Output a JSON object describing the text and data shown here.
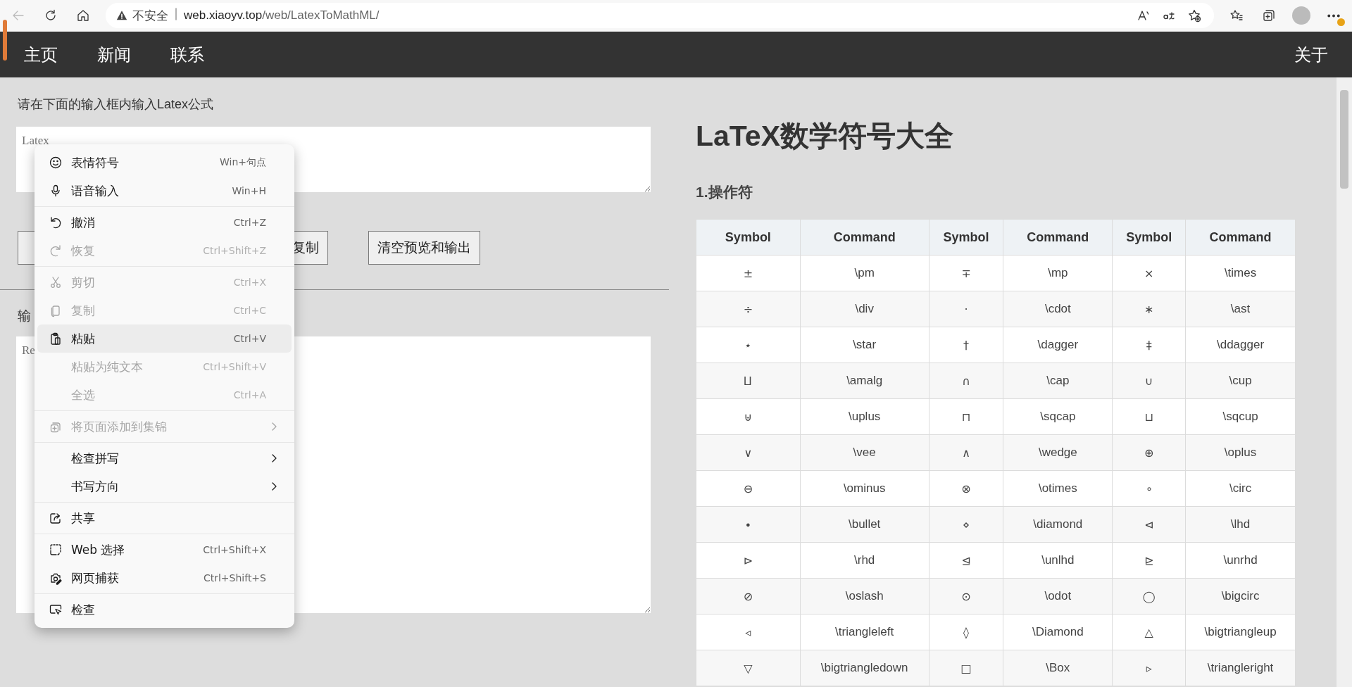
{
  "browser": {
    "security": "不安全",
    "url_host": "web.xiaoyv.top",
    "url_path": "/web/LatexToMathML/",
    "back_disabled": true
  },
  "nav": {
    "items": [
      "主页",
      "新闻",
      "联系"
    ],
    "right": "关于"
  },
  "editor": {
    "instruction": "请在下面的输入框内输入Latex公式",
    "input_placeholder": "Latex",
    "buttons": [
      "复制",
      "清空预览和输出"
    ],
    "output_label": "输",
    "output_placeholder": "Re"
  },
  "reference": {
    "title": "LaTeX数学符号大全",
    "section": "1.操作符",
    "table": {
      "columns": [
        "Symbol",
        "Command",
        "Symbol",
        "Command",
        "Symbol",
        "Command"
      ],
      "rows": [
        [
          "±",
          "\\pm",
          "∓",
          "\\mp",
          "×",
          "\\times"
        ],
        [
          "÷",
          "\\div",
          "·",
          "\\cdot",
          "∗",
          "\\ast"
        ],
        [
          "⋆",
          "\\star",
          "†",
          "\\dagger",
          "‡",
          "\\ddagger"
        ],
        [
          "⨿",
          "\\amalg",
          "∩",
          "\\cap",
          "∪",
          "\\cup"
        ],
        [
          "⊎",
          "\\uplus",
          "⊓",
          "\\sqcap",
          "⊔",
          "\\sqcup"
        ],
        [
          "∨",
          "\\vee",
          "∧",
          "\\wedge",
          "⊕",
          "\\oplus"
        ],
        [
          "⊖",
          "\\ominus",
          "⊗",
          "\\otimes",
          "∘",
          "\\circ"
        ],
        [
          "∙",
          "\\bullet",
          "⋄",
          "\\diamond",
          "⊲",
          "\\lhd"
        ],
        [
          "⊳",
          "\\rhd",
          "⊴",
          "\\unlhd",
          "⊵",
          "\\unrhd"
        ],
        [
          "⊘",
          "\\oslash",
          "⊙",
          "\\odot",
          "◯",
          "\\bigcirc"
        ],
        [
          "◃",
          "\\triangleleft",
          "◊",
          "\\Diamond",
          "△",
          "\\bigtriangleup"
        ],
        [
          "▽",
          "\\bigtriangledown",
          "□",
          "\\Box",
          "▹",
          "\\triangleright"
        ]
      ]
    }
  },
  "context_menu": {
    "groups": [
      [
        {
          "kind": "emoji",
          "label": "表情符号",
          "shortcut": "Win+句点",
          "disabled": false,
          "selected": false,
          "submenu": false
        },
        {
          "kind": "mic",
          "label": "语音输入",
          "shortcut": "Win+H",
          "disabled": false,
          "selected": false,
          "submenu": false
        }
      ],
      [
        {
          "kind": "undo",
          "label": "撤消",
          "shortcut": "Ctrl+Z",
          "disabled": false,
          "selected": false,
          "submenu": false
        },
        {
          "kind": "redo",
          "label": "恢复",
          "shortcut": "Ctrl+Shift+Z",
          "disabled": true,
          "selected": false,
          "submenu": false
        }
      ],
      [
        {
          "kind": "cut",
          "label": "剪切",
          "shortcut": "Ctrl+X",
          "disabled": true,
          "selected": false,
          "submenu": false
        },
        {
          "kind": "copy",
          "label": "复制",
          "shortcut": "Ctrl+C",
          "disabled": true,
          "selected": false,
          "submenu": false
        },
        {
          "kind": "paste",
          "label": "粘贴",
          "shortcut": "Ctrl+V",
          "disabled": false,
          "selected": true,
          "submenu": false
        },
        {
          "kind": "plain",
          "label": "粘贴为纯文本",
          "shortcut": "Ctrl+Shift+V",
          "disabled": true,
          "selected": false,
          "submenu": false
        },
        {
          "kind": "plain",
          "label": "全选",
          "shortcut": "Ctrl+A",
          "disabled": true,
          "selected": false,
          "submenu": false
        }
      ],
      [
        {
          "kind": "collection",
          "label": "将页面添加到集锦",
          "disabled": true,
          "selected": false,
          "submenu": true
        }
      ],
      [
        {
          "kind": "plain",
          "label": "检查拼写",
          "disabled": false,
          "selected": false,
          "submenu": true
        },
        {
          "kind": "plain",
          "label": "书写方向",
          "disabled": false,
          "selected": false,
          "submenu": true
        }
      ],
      [
        {
          "kind": "share",
          "label": "共享",
          "disabled": false,
          "selected": false,
          "submenu": false
        }
      ],
      [
        {
          "kind": "select",
          "label": "Web 选择",
          "shortcut": "Ctrl+Shift+X",
          "disabled": false,
          "selected": false,
          "submenu": false
        },
        {
          "kind": "capture",
          "label": "网页捕获",
          "shortcut": "Ctrl+Shift+S",
          "disabled": false,
          "selected": false,
          "submenu": false
        }
      ],
      [
        {
          "kind": "inspect",
          "label": "检查",
          "disabled": false,
          "selected": false,
          "submenu": false
        }
      ]
    ]
  }
}
